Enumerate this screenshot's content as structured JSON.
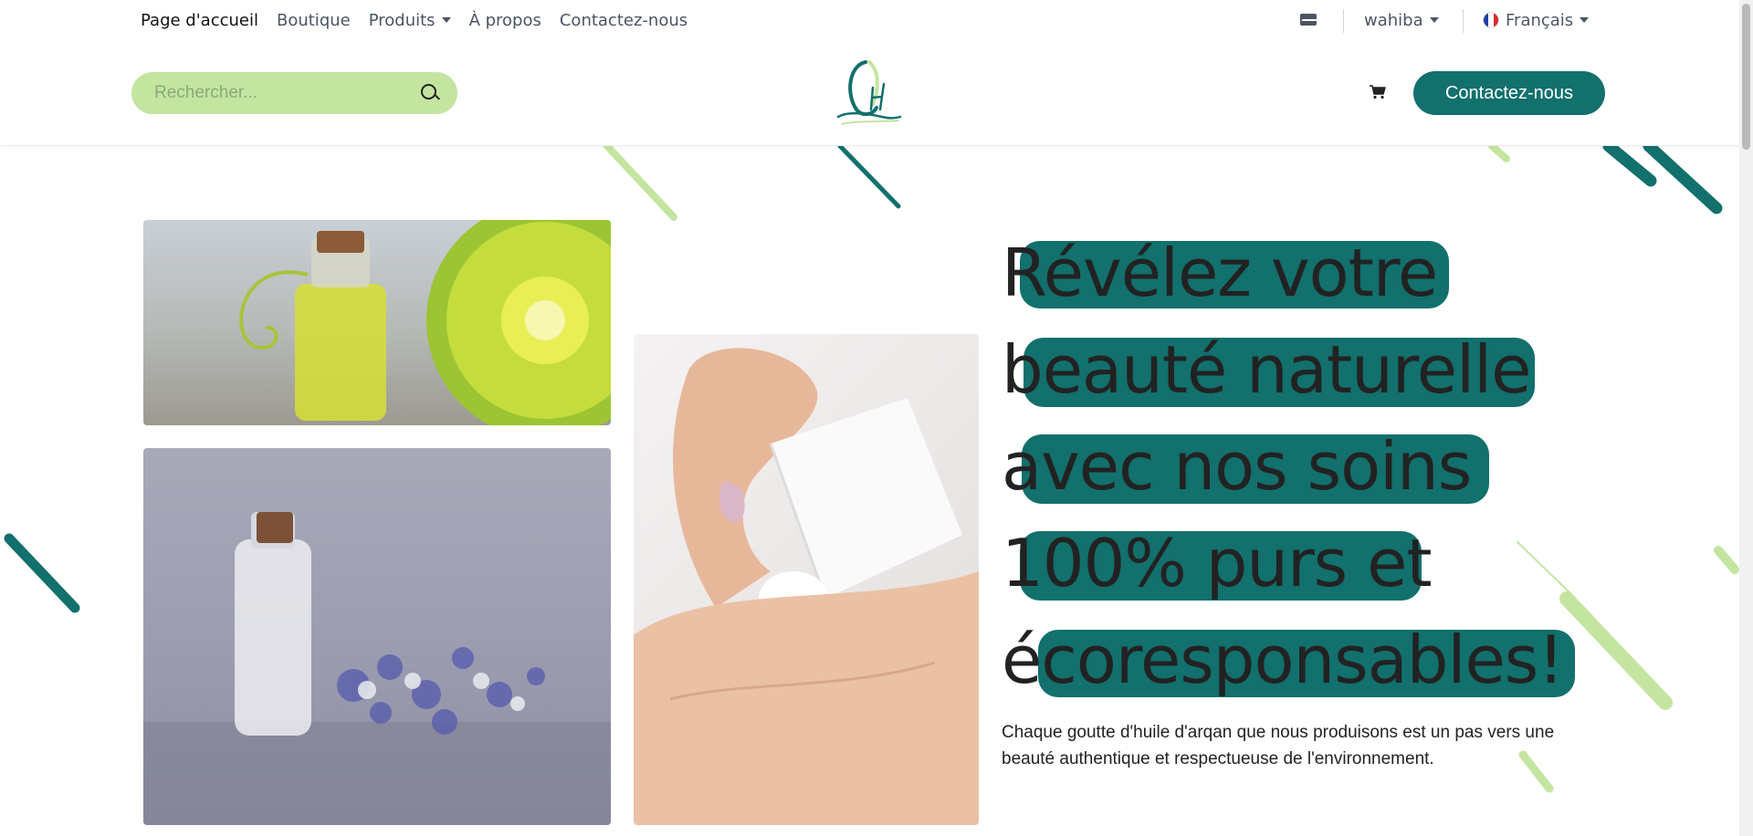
{
  "nav": {
    "items": [
      {
        "label": "Page d'accueil",
        "active": true,
        "dropdown": false
      },
      {
        "label": "Boutique",
        "active": false,
        "dropdown": false
      },
      {
        "label": "Produits",
        "active": false,
        "dropdown": true
      },
      {
        "label": "À propos",
        "active": false,
        "dropdown": false
      },
      {
        "label": "Contactez-nous",
        "active": false,
        "dropdown": false
      }
    ],
    "user": "wahiba",
    "language": "Français"
  },
  "header": {
    "search_placeholder": "Rechercher...",
    "cta_label": "Contactez-nous"
  },
  "hero": {
    "title_lines": [
      "Révélez votre",
      "beauté naturelle",
      "avec nos soins",
      "100% purs et",
      "écoresponsables!"
    ],
    "subtitle": "Chaque goutte d'huile d'arqan que nous produisons est un pas vers une beauté authentique et respectueuse de l'environnement."
  },
  "colors": {
    "brand_teal": "#12706d",
    "brand_green": "#c4e5a0"
  },
  "icons": [
    "envelope-icon",
    "search-icon",
    "cart-icon",
    "chevron-down-icon",
    "french-flag-icon"
  ]
}
